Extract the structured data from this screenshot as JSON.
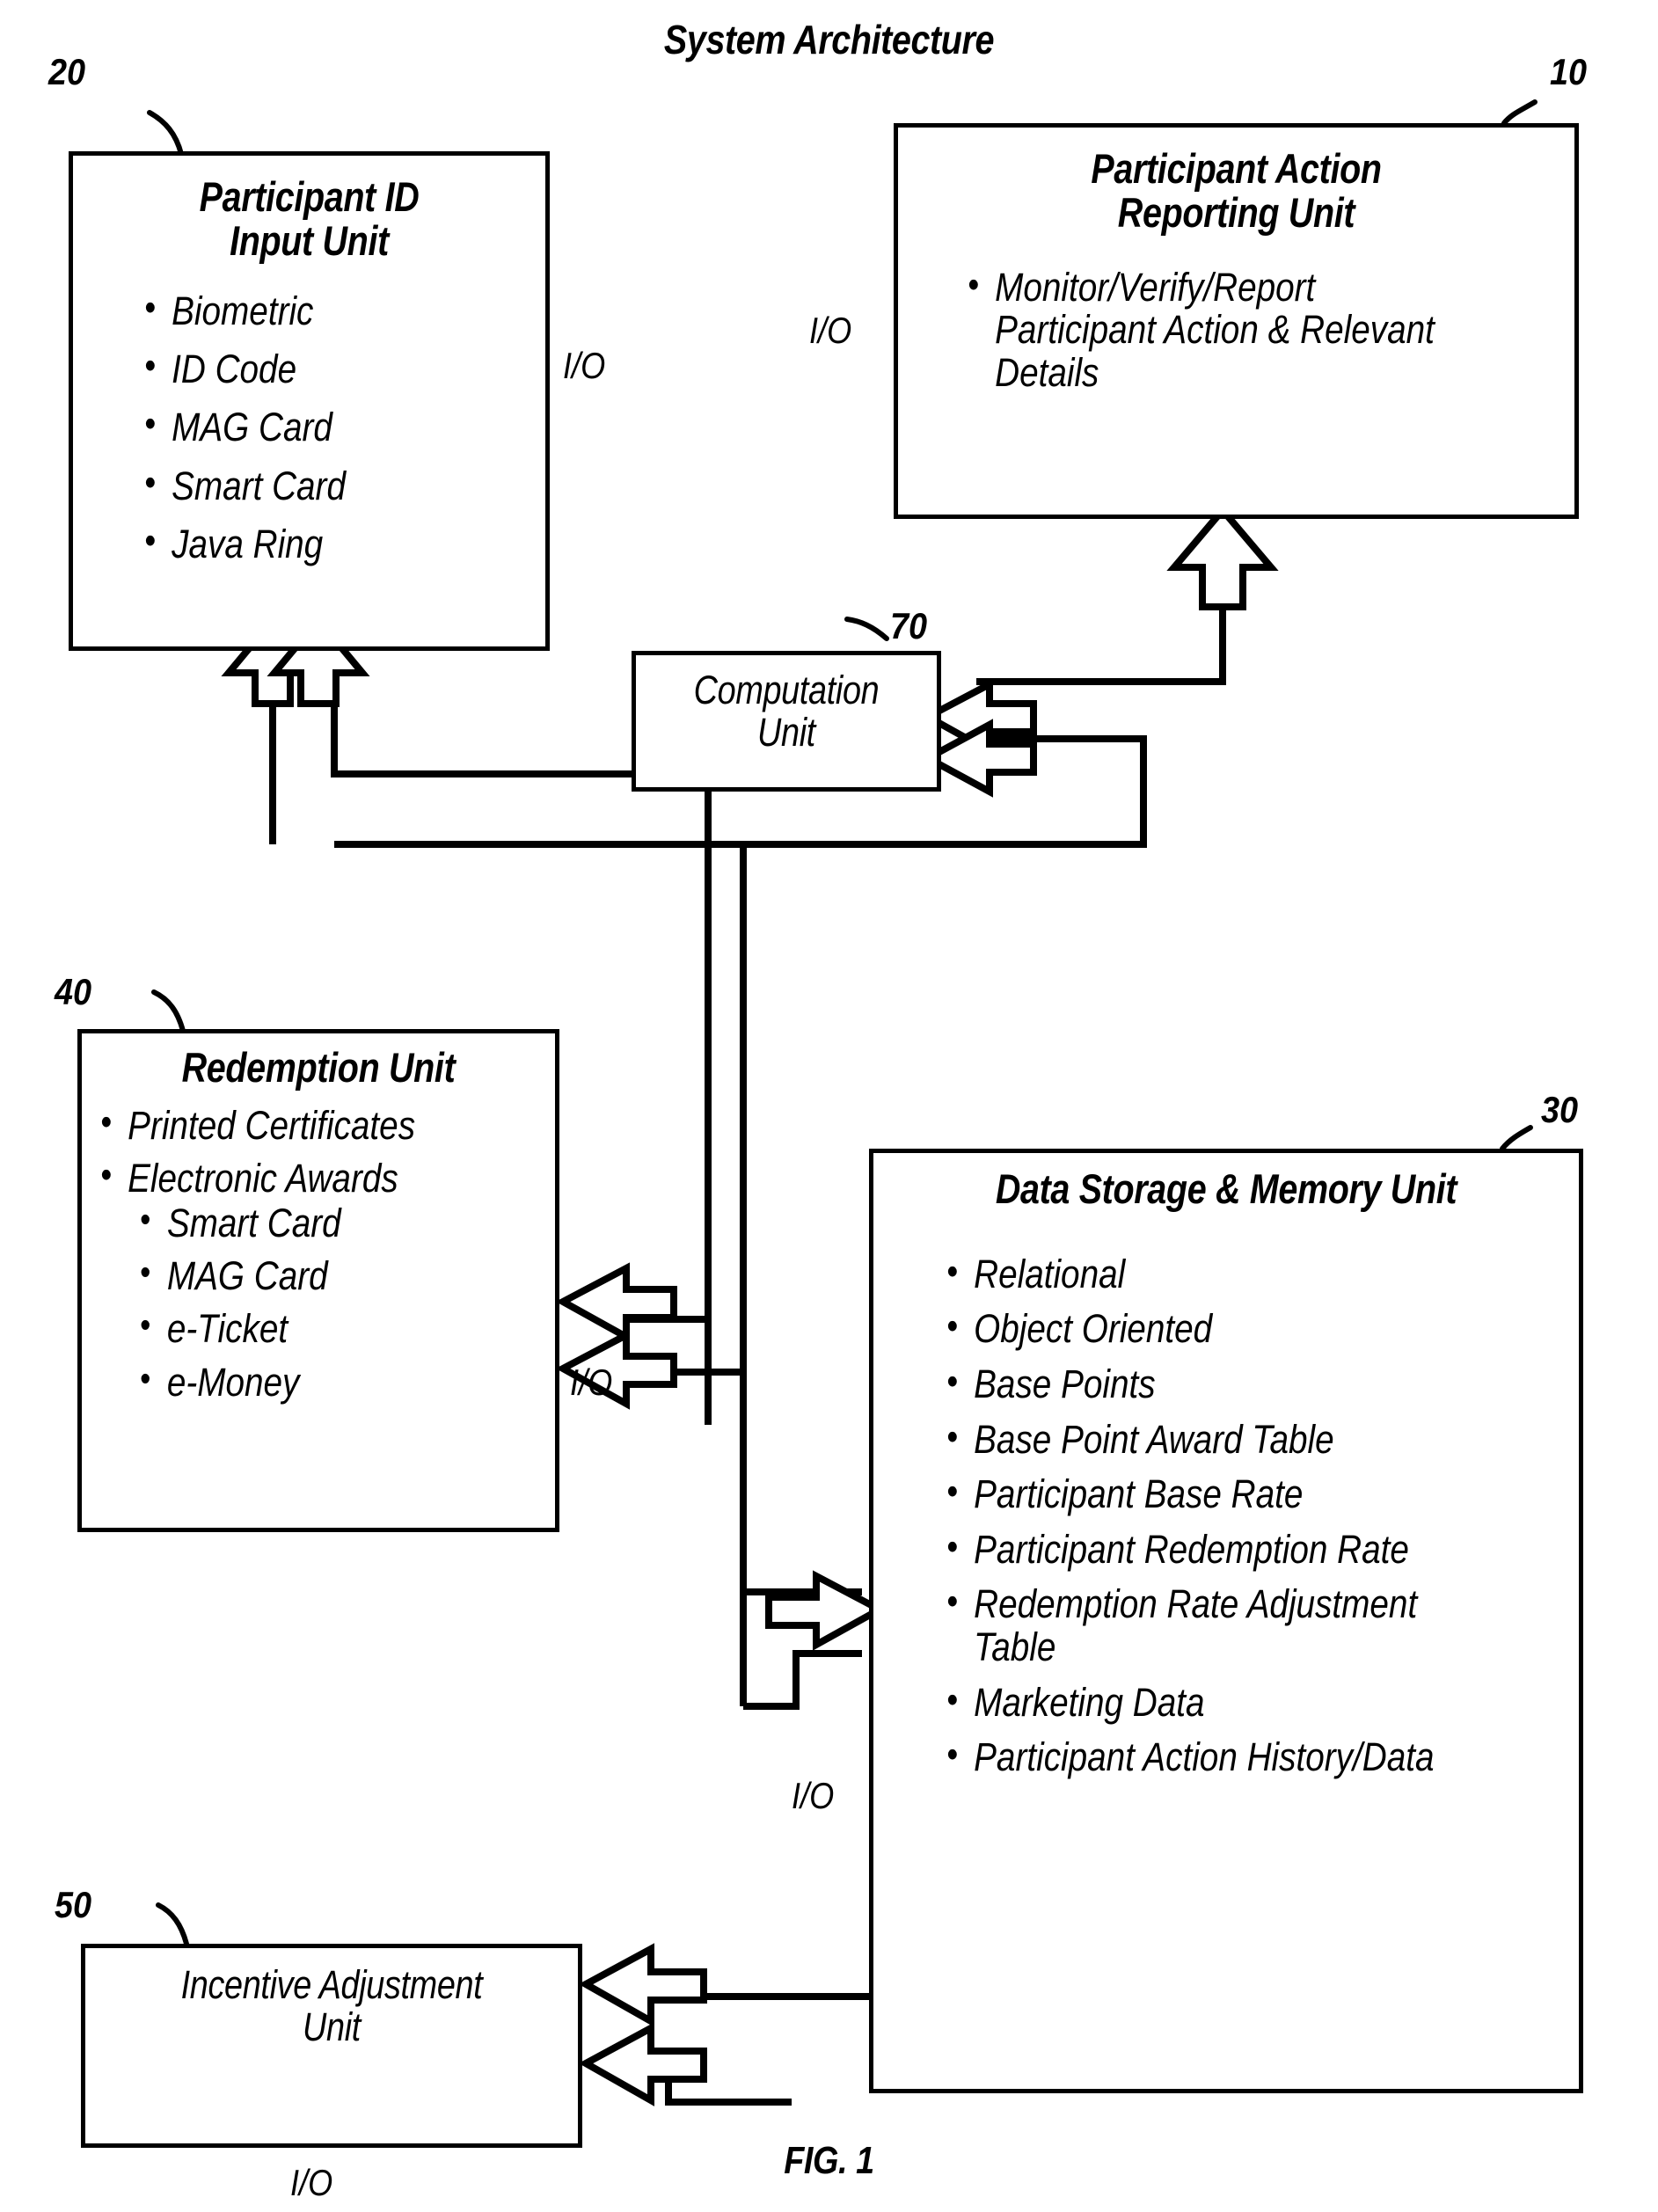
{
  "figure": {
    "title": "System Architecture",
    "caption": "FIG. 1"
  },
  "boxes": {
    "participant_id": {
      "ref": "20",
      "title_line1": "Participant ID",
      "title_line2": "Input Unit",
      "items": [
        "Biometric",
        "ID Code",
        "MAG Card",
        "Smart Card",
        "Java Ring"
      ]
    },
    "reporting": {
      "ref": "10",
      "title_line1": "Participant Action",
      "title_line2": "Reporting Unit",
      "items": [
        "Monitor/Verify/Report Participant Action & Relevant Details"
      ]
    },
    "computation": {
      "ref": "70",
      "title_line1": "Computation",
      "title_line2": "Unit"
    },
    "redemption": {
      "ref": "40",
      "title_line1": "Redemption Unit",
      "items": [
        "Printed Certificates",
        "Electronic Awards"
      ],
      "sub_items": [
        "Smart Card",
        "MAG Card",
        "e-Ticket",
        "e-Money"
      ]
    },
    "storage": {
      "ref": "30",
      "title_line1": "Data Storage & Memory Unit",
      "items": [
        "Relational",
        "Object Oriented",
        "Base Points",
        "Base Point Award Table",
        "Participant Base Rate",
        "Participant Redemption Rate",
        "Redemption Rate Adjustment Table",
        "Marketing Data",
        "Participant Action History/Data"
      ]
    },
    "incentive": {
      "ref": "50",
      "title_line1": "Incentive Adjustment",
      "title_line2": "Unit"
    }
  },
  "io_labels": {
    "between_id_and_reporting_left": "I/O",
    "between_id_and_reporting_right": "I/O",
    "redemption_storage": "I/O",
    "storage_incentive": "I/O",
    "incentive_bottom": "I/O"
  },
  "colors": {
    "line": "#000000",
    "background": "#ffffff"
  }
}
